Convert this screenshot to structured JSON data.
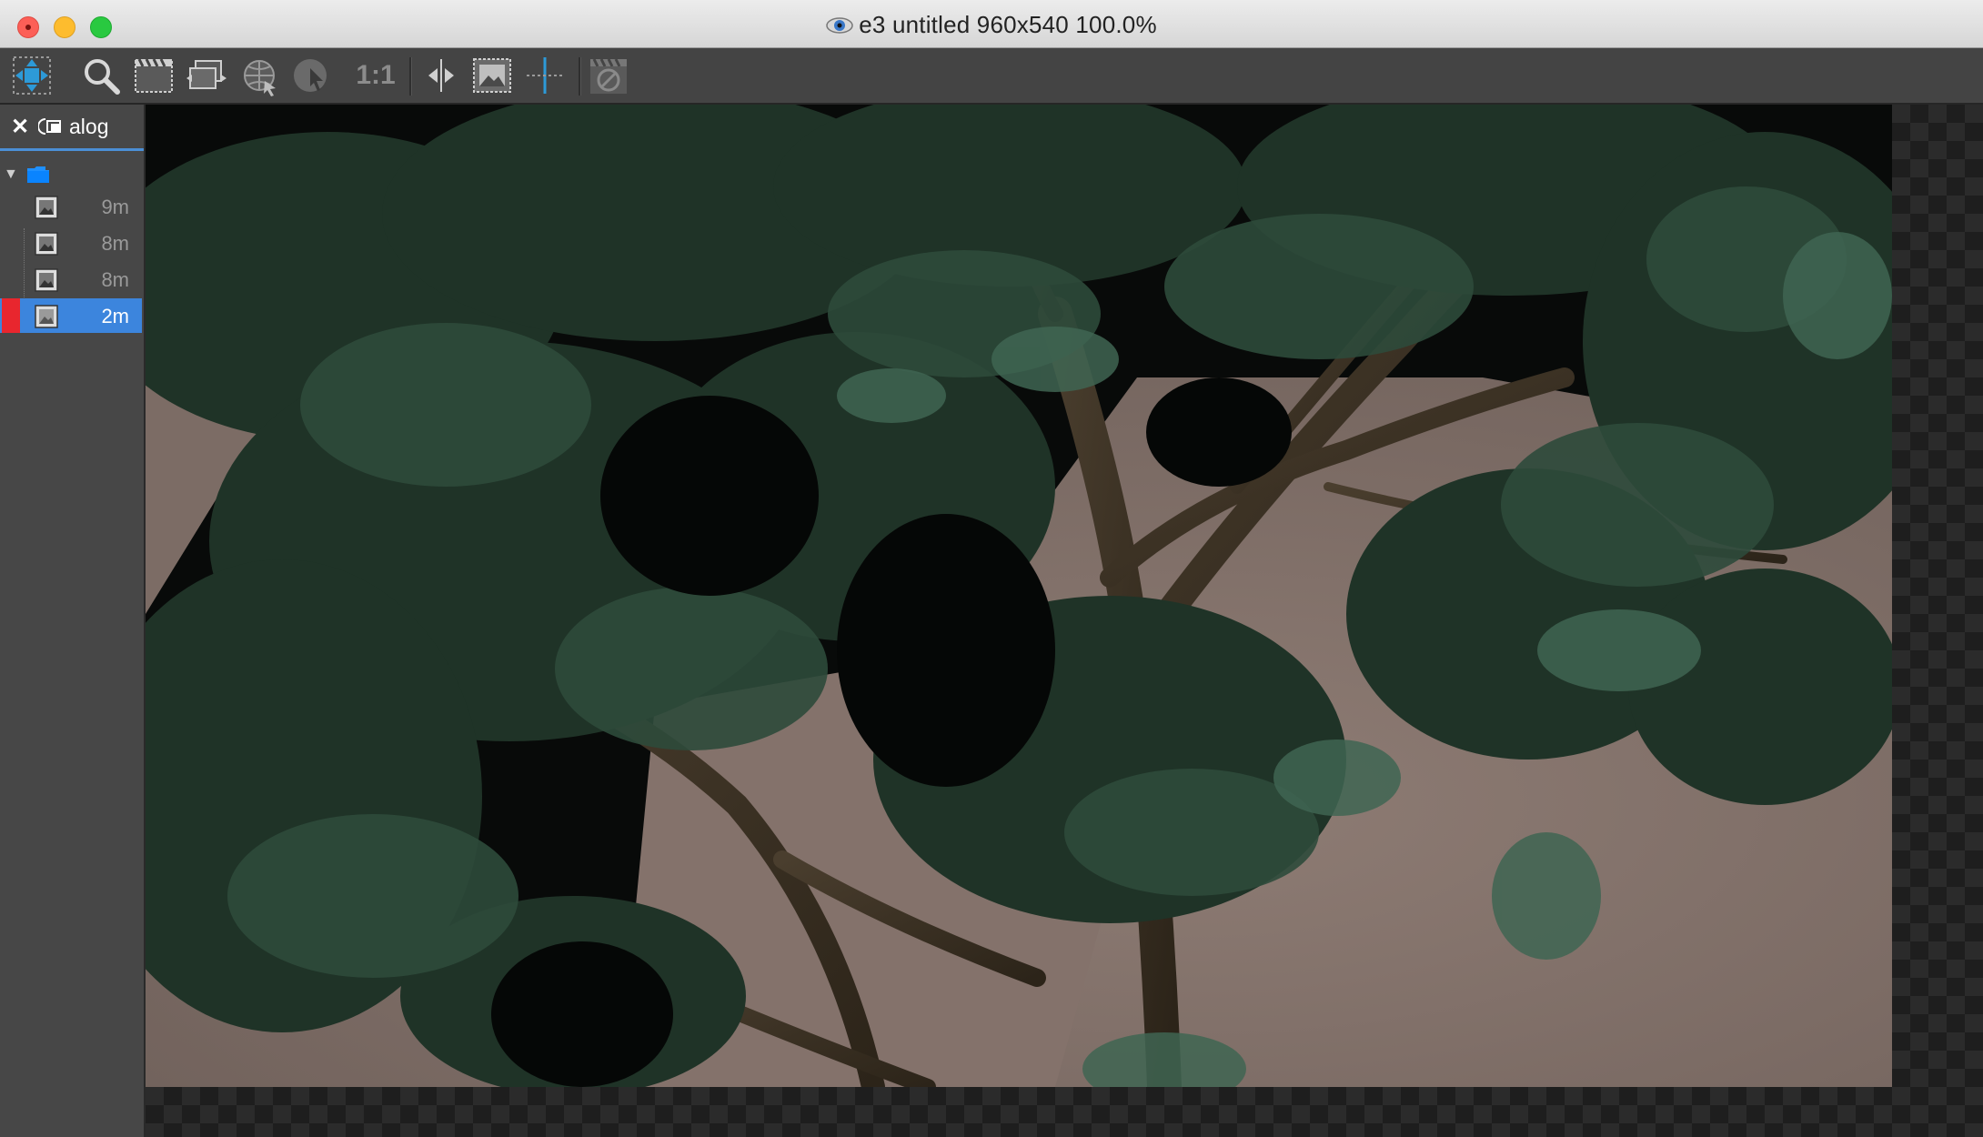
{
  "window": {
    "title": "e3 untitled 960x540 100.0%",
    "close_button": "close",
    "minimize_button": "minimize",
    "zoom_button": "zoom"
  },
  "toolbar": {
    "tools": [
      "move-icon",
      "zoom-icon",
      "frame-icon",
      "layers-icon",
      "globe-icon",
      "cursor-icon",
      "one-to-one",
      "split-icon",
      "image-icon",
      "crosshair-icon",
      "clapper-icon"
    ],
    "one_to_one_label": "1:1",
    "accent_color": "#2d9ad8"
  },
  "sidebar": {
    "tab_label": "alog",
    "items": [
      {
        "time": "9m",
        "selected": false
      },
      {
        "time": "8m",
        "selected": false
      },
      {
        "time": "8m",
        "selected": false
      },
      {
        "time": "2m",
        "selected": true
      }
    ],
    "selected_color": "#3c85dd",
    "marker_color": "#e8262e"
  },
  "viewport": {
    "content": "rendered tree foliage image",
    "background": "checkerboard"
  }
}
